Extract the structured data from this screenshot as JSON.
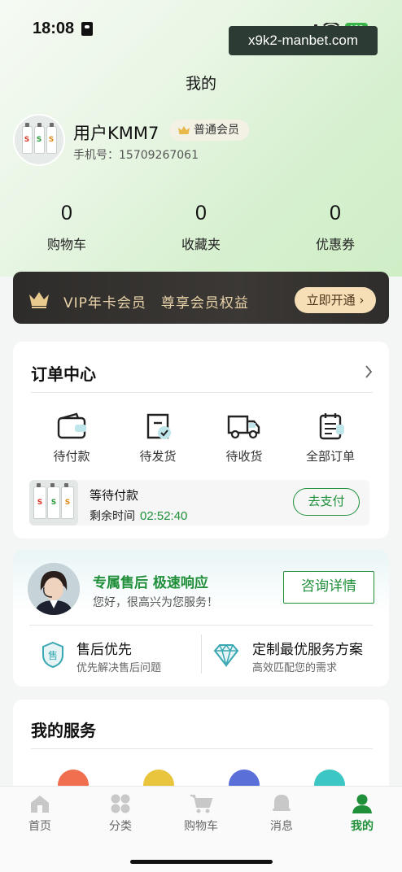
{
  "status_bar": {
    "time": "18:08",
    "battery": "100"
  },
  "watermark": "x9k2-manbet.com",
  "header": {
    "title": "我的"
  },
  "profile": {
    "username": "用户KMM7",
    "member_level": "普通会员",
    "phone_label": "手机号：15709267061",
    "bottle_letter": "S"
  },
  "stats": [
    {
      "value": "0",
      "label": "购物车"
    },
    {
      "value": "0",
      "label": "收藏夹"
    },
    {
      "value": "0",
      "label": "优惠券"
    }
  ],
  "vip": {
    "text": "VIP年卡会员　尊享会员权益",
    "button": "立即开通"
  },
  "orders": {
    "title": "订单中心",
    "items": [
      {
        "label": "待付款",
        "icon": "wallet-icon"
      },
      {
        "label": "待发货",
        "icon": "package-icon"
      },
      {
        "label": "待收货",
        "icon": "truck-icon"
      },
      {
        "label": "全部订单",
        "icon": "clipboard-icon"
      }
    ],
    "pending": {
      "title": "等待付款",
      "remaining_label": "剩余时间",
      "remaining_time": "02:52:40",
      "pay_button": "去支付"
    }
  },
  "support": {
    "title": "专属售后 极速响应",
    "subtitle": "您好，很高兴为您服务！",
    "button": "咨询详情",
    "features": [
      {
        "title": "售后优先",
        "subtitle": "优先解决售后问题",
        "icon": "shield-icon",
        "icon_text": "售"
      },
      {
        "title": "定制最优服务方案",
        "subtitle": "高效匹配您的需求",
        "icon": "diamond-icon"
      }
    ]
  },
  "my_services": {
    "title": "我的服务"
  },
  "tabbar": {
    "items": [
      {
        "label": "首页",
        "icon": "home-icon"
      },
      {
        "label": "分类",
        "icon": "category-icon"
      },
      {
        "label": "购物车",
        "icon": "cart-icon"
      },
      {
        "label": "消息",
        "icon": "bell-icon"
      },
      {
        "label": "我的",
        "icon": "user-icon",
        "active": true
      }
    ]
  },
  "colors": {
    "accent": "#1f8f3a",
    "vip_gold": "#e8d2a8",
    "vip_bg": "#2e2c2a"
  }
}
